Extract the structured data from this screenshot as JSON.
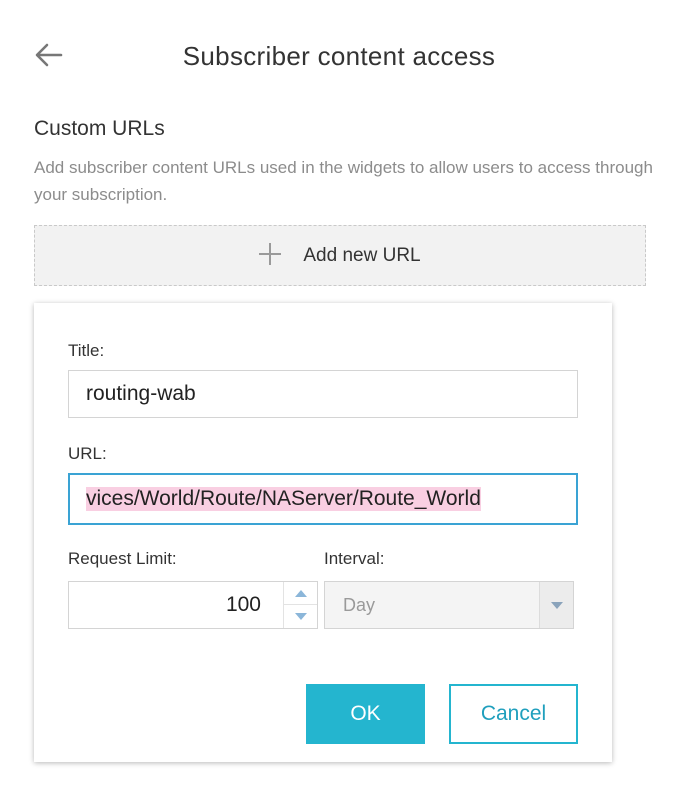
{
  "header": {
    "title": "Subscriber content access",
    "back_icon": "arrow-left-icon"
  },
  "custom_urls": {
    "title": "Custom URLs",
    "description": "Add subscriber content URLs used in the widgets to allow users to access through your subscription.",
    "add_button_label": "Add new URL",
    "add_icon": "plus-icon"
  },
  "dialog": {
    "title_label": "Title:",
    "title_value": "routing-wab",
    "url_label": "URL:",
    "url_value": "vices/World/Route/NAServer/Route_World",
    "request_limit_label": "Request Limit:",
    "request_limit_value": "100",
    "interval_label": "Interval:",
    "interval_value": "Day",
    "ok_label": "OK",
    "cancel_label": "Cancel"
  },
  "colors": {
    "accent": "#24b5cf",
    "focus_border": "#3aa3d4",
    "selection_highlight": "#f9cfe2"
  }
}
